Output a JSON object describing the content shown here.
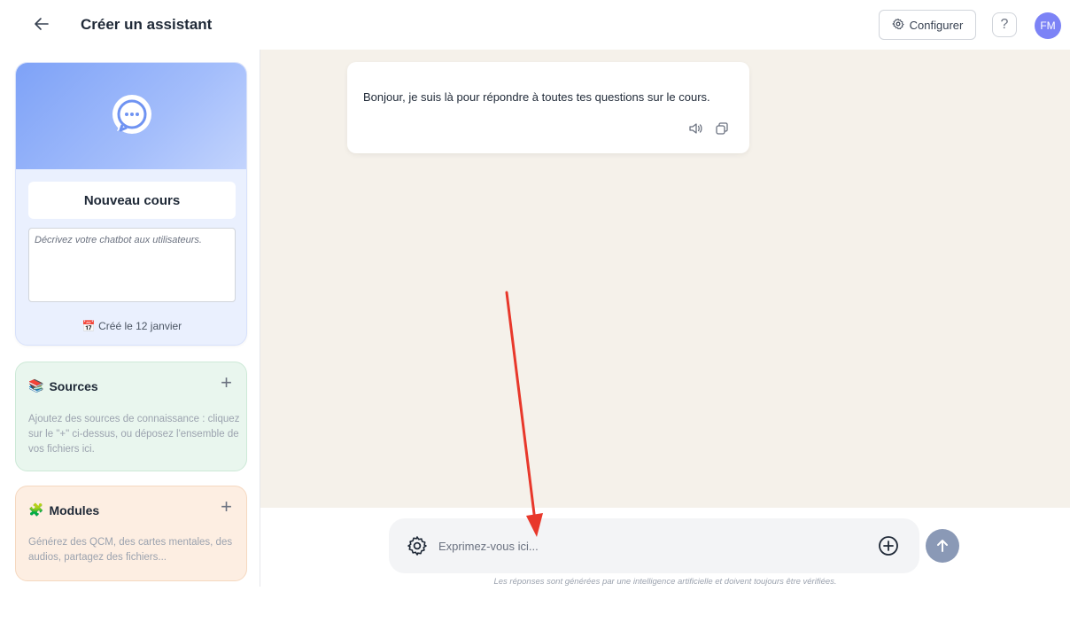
{
  "header": {
    "title": "Créer un assistant",
    "configure_label": "Configurer",
    "help_label": "?",
    "avatar_initials": "FM"
  },
  "sidebar": {
    "assistant": {
      "name": "Nouveau cours",
      "description_placeholder": "Décrivez votre chatbot aux utilisateurs.",
      "created_label": "Créé le 12 janvier",
      "created_icon": "calendar-icon"
    },
    "sources": {
      "title": "Sources",
      "icon": "books-icon",
      "add_label": "+",
      "description": "Ajoutez des sources de connaissance : cliquez sur le \"+\" ci-dessus, ou déposez l'ensemble de vos fichiers ici."
    },
    "modules": {
      "title": "Modules",
      "icon": "puzzle-icon",
      "add_label": "+",
      "description": "Générez des QCM, des cartes mentales, des audios, partagez des fichiers..."
    }
  },
  "chat": {
    "messages": [
      {
        "role": "assistant",
        "text": "Bonjour, je suis là pour répondre à toutes tes questions sur le cours."
      }
    ],
    "input_placeholder": "Exprimez-vous ici...",
    "disclaimer": "Les réponses sont générées par une intelligence artificielle et doivent toujours être vérifiées."
  },
  "colors": {
    "chat_background": "#f5f1ea",
    "avatar": "#7c83f6",
    "send_button": "#8a99b6",
    "annotation_arrow": "#e8382b",
    "sources_card": "#e9f6ee",
    "modules_card": "#fdeee2"
  }
}
